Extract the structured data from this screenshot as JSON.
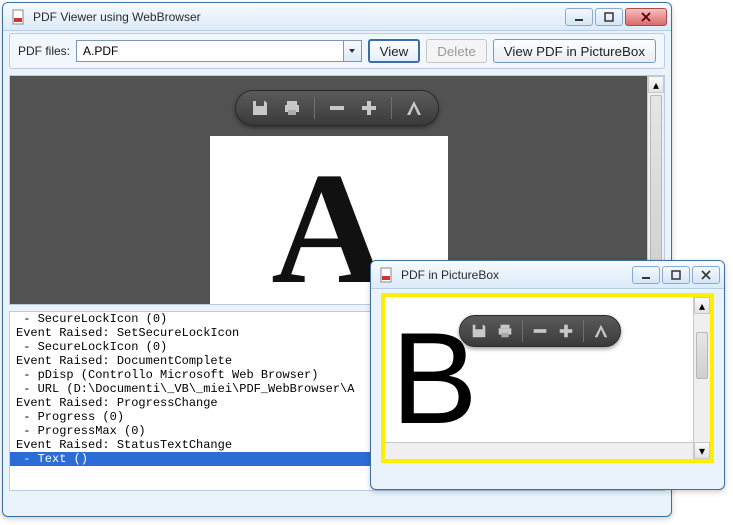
{
  "main_window": {
    "title": "PDF Viewer using WebBrowser",
    "toolbar": {
      "label": "PDF files:",
      "selected_file": "A.PDF",
      "view_label": "View",
      "delete_label": "Delete",
      "view_picturebox_label": "View PDF in PictureBox"
    },
    "page_letter": "A",
    "log_lines": [
      " - SecureLockIcon (0)",
      "Event Raised: SetSecureLockIcon",
      " - SecureLockIcon (0)",
      "Event Raised: DocumentComplete",
      " - pDisp (Controllo Microsoft Web Browser)",
      " - URL (D:\\Documenti\\_VB\\_miei\\PDF_WebBrowser\\A",
      "Event Raised: ProgressChange",
      " - Progress (0)",
      " - ProgressMax (0)",
      "Event Raised: StatusTextChange",
      " - Text ()"
    ],
    "log_selected_index": 10
  },
  "picturebox_window": {
    "title": "PDF in PictureBox",
    "page_letter": "B"
  }
}
